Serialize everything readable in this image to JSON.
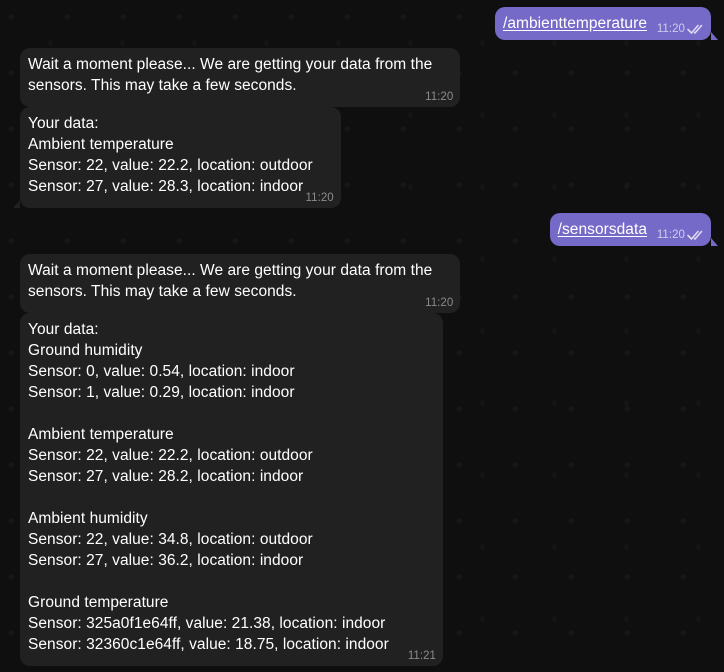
{
  "messages": {
    "cmd1": {
      "text": "/ambienttemperature",
      "time": "11:20"
    },
    "wait1": {
      "lines": [
        "Wait a moment please... We are getting your data from the",
        "sensors. This may take a few seconds."
      ],
      "time": "11:20"
    },
    "data1": {
      "lines": [
        "Your data:",
        "Ambient temperature",
        "Sensor: 22, value: 22.2, location: outdoor",
        "Sensor: 27, value: 28.3, location: indoor"
      ],
      "time": "11:20"
    },
    "cmd2": {
      "text": "/sensorsdata",
      "time": "11:20"
    },
    "wait2": {
      "lines": [
        "Wait a moment please... We are getting your data from the",
        "sensors. This may take a few seconds."
      ],
      "time": "11:20"
    },
    "data2": {
      "lines": [
        "Your data:",
        "Ground humidity",
        "Sensor: 0, value: 0.54, location: indoor",
        "Sensor: 1, value: 0.29, location: indoor",
        "",
        "Ambient temperature",
        "Sensor: 22, value: 22.2, location: outdoor",
        "Sensor: 27, value: 28.2, location: indoor",
        "",
        "Ambient humidity",
        "Sensor: 22, value: 34.8, location: outdoor",
        "Sensor: 27, value: 36.2, location: indoor",
        "",
        "Ground temperature",
        "Sensor: 325a0f1e64ff, value: 21.38, location: indoor",
        "Sensor: 32360c1e64ff, value: 18.75, location: indoor"
      ],
      "time": "11:21"
    }
  },
  "colors": {
    "outgoing_bubble": "#766ac8",
    "incoming_bubble": "#212121",
    "background": "#0f0f0f"
  },
  "icons": {
    "read_receipt": "double-check-icon"
  }
}
